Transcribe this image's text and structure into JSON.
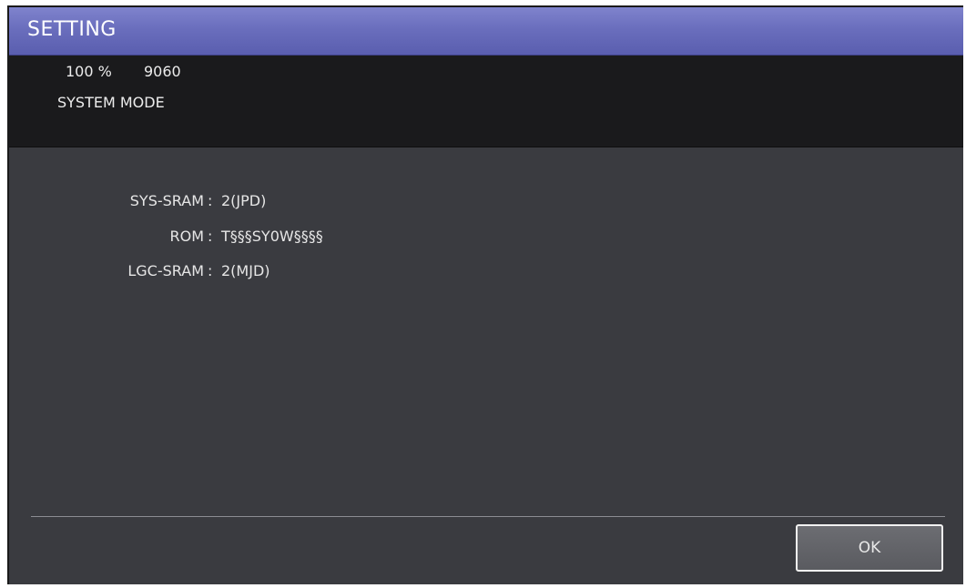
{
  "window": {
    "title": "SETTING"
  },
  "status": {
    "zoom": "100 %",
    "count": "9060",
    "mode": "SYSTEM MODE"
  },
  "info": [
    {
      "label": "SYS-SRAM",
      "separator": ":",
      "value": "2(JPD)"
    },
    {
      "label": "ROM",
      "separator": ":",
      "value": "T§§§SY0W§§§§"
    },
    {
      "label": "LGC-SRAM",
      "separator": ":",
      "value": "2(MJD)"
    }
  ],
  "footer": {
    "ok_label": "OK"
  },
  "colors": {
    "titlebar": "#6a6ebd",
    "status_panel": "#1a1a1c",
    "content_bg": "#3a3b40",
    "button_border": "#f2f2f2"
  }
}
